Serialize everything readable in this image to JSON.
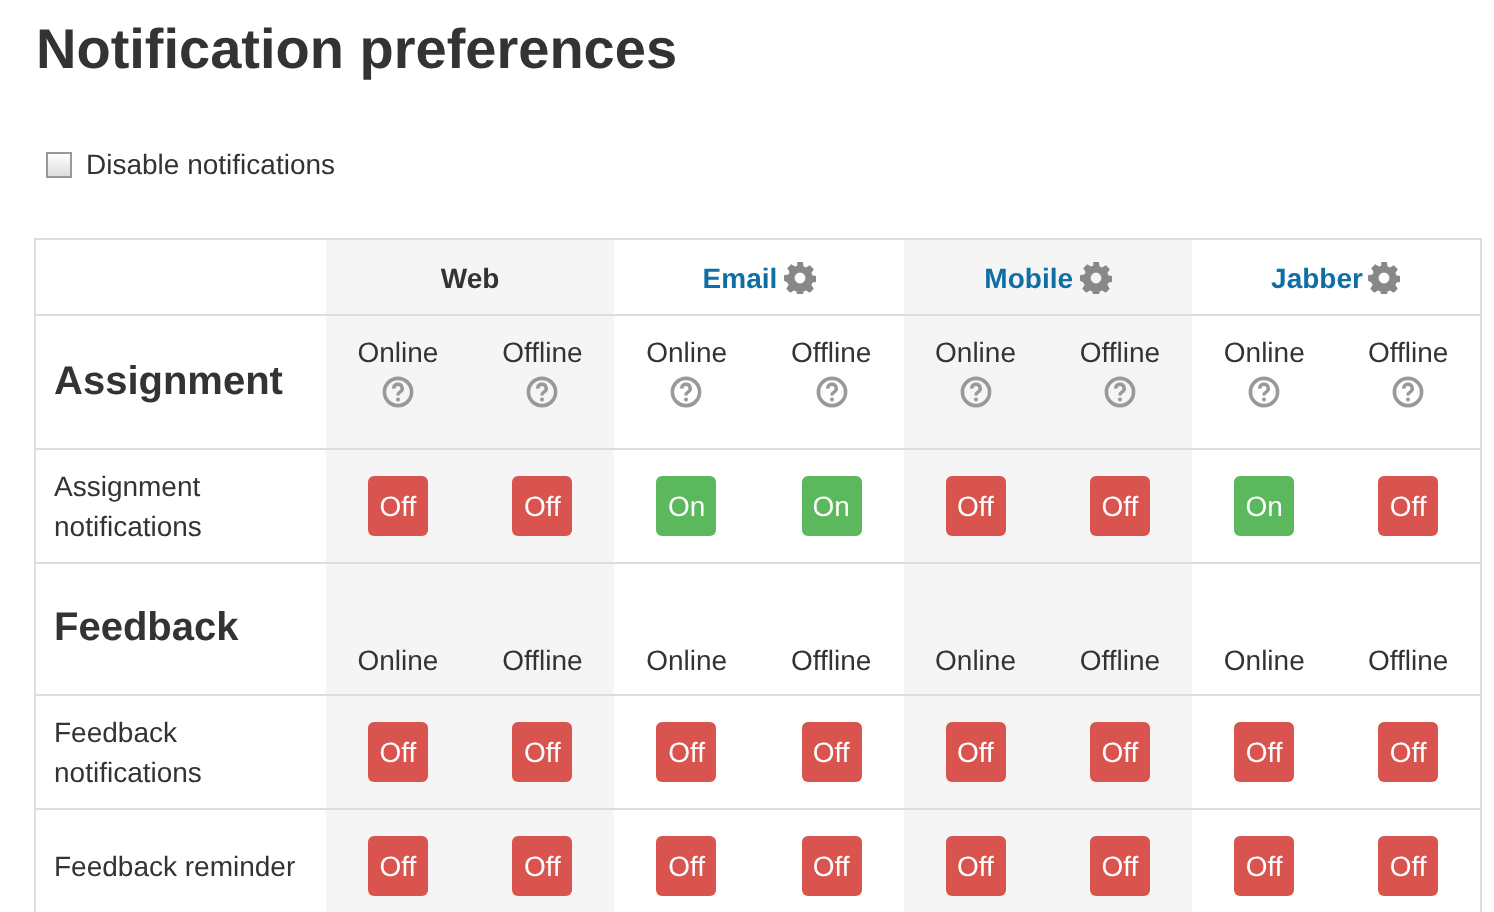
{
  "title": "Notification preferences",
  "disable_notifications": {
    "label": "Disable notifications",
    "checked": false
  },
  "processors": [
    {
      "name": "Web",
      "configurable": false
    },
    {
      "name": "Email",
      "configurable": true
    },
    {
      "name": "Mobile",
      "configurable": true
    },
    {
      "name": "Jabber",
      "configurable": true
    }
  ],
  "sections": [
    {
      "title": "Assignment",
      "columns": [
        {
          "label": "Online",
          "help": true
        },
        {
          "label": "Offline",
          "help": true
        },
        {
          "label": "Online",
          "help": true
        },
        {
          "label": "Offline",
          "help": true
        },
        {
          "label": "Online",
          "help": true
        },
        {
          "label": "Offline",
          "help": true
        },
        {
          "label": "Online",
          "help": true
        },
        {
          "label": "Offline",
          "help": true
        }
      ],
      "rows": [
        {
          "label": "Assignment notifications",
          "toggles": [
            {
              "label": "Off",
              "on": false
            },
            {
              "label": "Off",
              "on": false
            },
            {
              "label": "On",
              "on": true
            },
            {
              "label": "On",
              "on": true
            },
            {
              "label": "Off",
              "on": false
            },
            {
              "label": "Off",
              "on": false
            },
            {
              "label": "On",
              "on": true
            },
            {
              "label": "Off",
              "on": false
            }
          ]
        }
      ]
    },
    {
      "title": "Feedback",
      "columns": [
        {
          "label": "Online",
          "help": false
        },
        {
          "label": "Offline",
          "help": false
        },
        {
          "label": "Online",
          "help": false
        },
        {
          "label": "Offline",
          "help": false
        },
        {
          "label": "Online",
          "help": false
        },
        {
          "label": "Offline",
          "help": false
        },
        {
          "label": "Online",
          "help": false
        },
        {
          "label": "Offline",
          "help": false
        }
      ],
      "rows": [
        {
          "label": "Feedback notifications",
          "toggles": [
            {
              "label": "Off",
              "on": false
            },
            {
              "label": "Off",
              "on": false
            },
            {
              "label": "Off",
              "on": false
            },
            {
              "label": "Off",
              "on": false
            },
            {
              "label": "Off",
              "on": false
            },
            {
              "label": "Off",
              "on": false
            },
            {
              "label": "Off",
              "on": false
            },
            {
              "label": "Off",
              "on": false
            }
          ]
        },
        {
          "label": "Feedback reminder",
          "toggles": [
            {
              "label": "Off",
              "on": false
            },
            {
              "label": "Off",
              "on": false
            },
            {
              "label": "Off",
              "on": false
            },
            {
              "label": "Off",
              "on": false
            },
            {
              "label": "Off",
              "on": false
            },
            {
              "label": "Off",
              "on": false
            },
            {
              "label": "Off",
              "on": false
            },
            {
              "label": "Off",
              "on": false
            }
          ]
        }
      ]
    }
  ]
}
